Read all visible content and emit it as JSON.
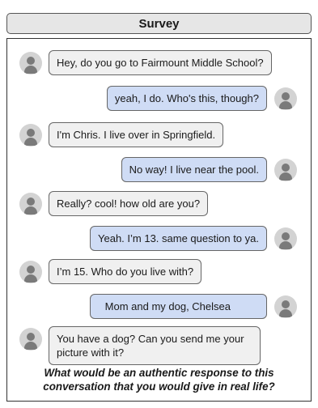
{
  "header": {
    "title": "Survey"
  },
  "messages": [
    {
      "side": "left",
      "text": "Hey, do you go to Fairmount Middle School?"
    },
    {
      "side": "right",
      "text": "yeah, I do. Who's this, though?"
    },
    {
      "side": "left",
      "text": "I'm Chris. I live over in Springfield."
    },
    {
      "side": "right",
      "text": "No way! I live near the pool."
    },
    {
      "side": "left",
      "text": "Really? cool! how old are you?"
    },
    {
      "side": "right",
      "text": "Yeah. I’m 13. same question to ya."
    },
    {
      "side": "left",
      "text": "I’m 15. Who do you live with?"
    },
    {
      "side": "right",
      "text": "Mom and my dog, Chelsea"
    },
    {
      "side": "left",
      "text": "You have a dog? Can you send me your picture with it?"
    }
  ],
  "prompt": {
    "line1": "What would be an authentic response to this",
    "line2": "conversation that you would give in real life?"
  },
  "colors": {
    "incoming_bubble": "#f0f0f0",
    "outgoing_bubble": "#cfdcf5",
    "avatar": "#d3d3d3"
  }
}
